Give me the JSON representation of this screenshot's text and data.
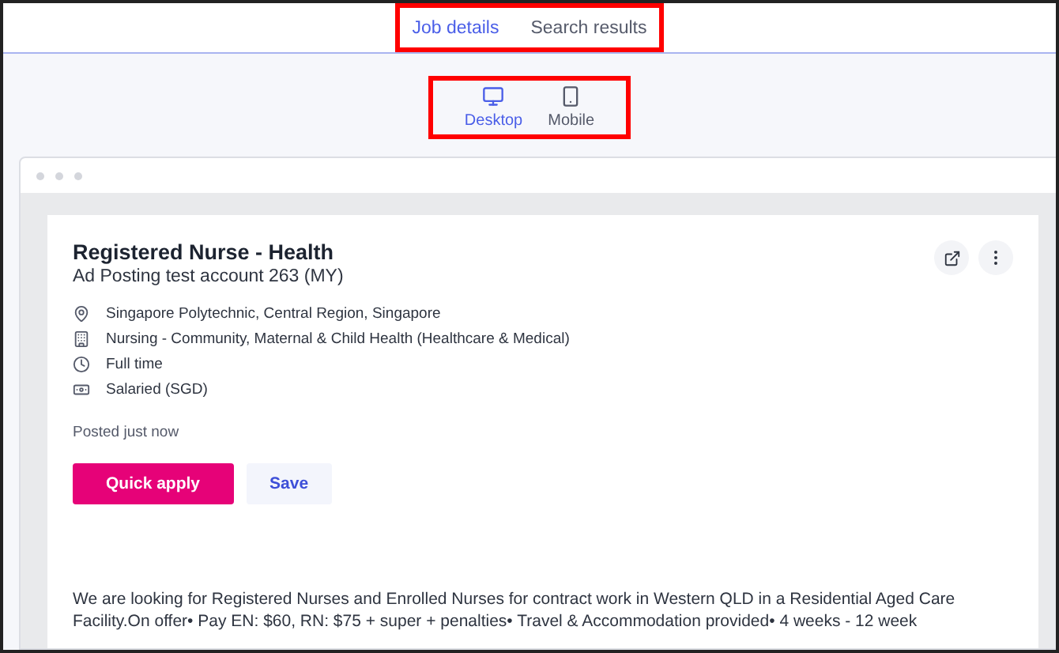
{
  "tabs": [
    {
      "label": "Job details",
      "selected": true
    },
    {
      "label": "Search results",
      "selected": false
    }
  ],
  "devices": [
    {
      "label": "Desktop",
      "kind": "desktop",
      "selected": true
    },
    {
      "label": "Mobile",
      "kind": "mobile",
      "selected": false
    }
  ],
  "job": {
    "title": "Registered Nurse - Health",
    "advertiser": "Ad Posting test account 263 (MY)",
    "details": [
      {
        "kind": "location",
        "text": "Singapore Polytechnic, Central Region, Singapore"
      },
      {
        "kind": "category",
        "text": "Nursing - Community, Maternal & Child Health (Healthcare & Medical)"
      },
      {
        "kind": "worktype",
        "text": "Full time"
      },
      {
        "kind": "salary",
        "text": "Salaried (SGD)"
      }
    ],
    "posted": "Posted just now",
    "buttons": [
      {
        "label": "Quick apply",
        "kind": "primary"
      },
      {
        "label": "Save",
        "kind": "secondary"
      }
    ],
    "description": "We are looking for Registered Nurses and Enrolled Nurses for contract work in Western QLD in a Residential Aged Care Facility.On offer• Pay EN: $60, RN: $75 + super + penalties• Travel & Accommodation provided• 4 weeks - 12 week"
  }
}
